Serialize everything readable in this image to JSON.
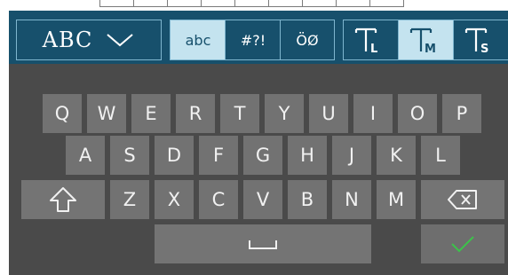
{
  "toolbar": {
    "layout_button": {
      "label": "ABC",
      "icon": "chevron-down-icon"
    },
    "charset_tabs": [
      {
        "label": "abc",
        "selected": true
      },
      {
        "label": "#?!",
        "selected": false
      },
      {
        "label": "ÖØ",
        "selected": false
      }
    ],
    "size_buttons": [
      {
        "letter": "L",
        "icon": "text-size-large-icon",
        "selected": false
      },
      {
        "letter": "M",
        "icon": "text-size-medium-icon",
        "selected": true
      },
      {
        "letter": "S",
        "icon": "text-size-small-icon",
        "selected": false
      }
    ]
  },
  "keyboard": {
    "row1": [
      "Q",
      "W",
      "E",
      "R",
      "T",
      "Y",
      "U",
      "I",
      "O",
      "P"
    ],
    "row2": [
      "A",
      "S",
      "D",
      "F",
      "G",
      "H",
      "J",
      "K",
      "L"
    ],
    "row3": [
      "Z",
      "X",
      "C",
      "V",
      "B",
      "N",
      "M"
    ],
    "shift_icon": "shift-arrow-icon",
    "backspace_icon": "backspace-icon",
    "space_icon": "space-bar-icon",
    "enter_icon": "checkmark-icon"
  },
  "colors": {
    "toolbar_bg": "#17506c",
    "selected_bg": "#c4e3ef",
    "keyboard_bg": "#4a4a4a",
    "key_bg": "#727272",
    "key_text": "#f1f1f1",
    "confirm_green": "#3cc24a"
  }
}
